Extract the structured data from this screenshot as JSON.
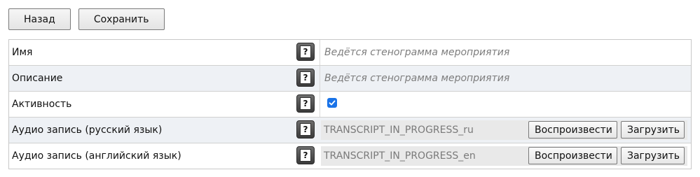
{
  "toolbar": {
    "back_label": "Назад",
    "save_label": "Сохранить"
  },
  "rows": [
    {
      "label": "Имя",
      "placeholder": "Ведётся стенограмма мероприятия"
    },
    {
      "label": "Описание",
      "placeholder": "Ведётся стенограмма мероприятия"
    },
    {
      "label": "Активность",
      "checked": true
    },
    {
      "label": "Аудио запись (русский язык)",
      "value": "TRANSCRIPT_IN_PROGRESS_ru",
      "play_label": "Воспроизвести",
      "upload_label": "Загрузить"
    },
    {
      "label": "Аудио запись (английский язык)",
      "value": "TRANSCRIPT_IN_PROGRESS_en",
      "play_label": "Воспроизвести",
      "upload_label": "Загрузить"
    }
  ],
  "help_icon": "question-mark-icon",
  "colors": {
    "accent": "#1a73e8",
    "alt_row": "#eef1f5",
    "border": "#c8c8c8"
  }
}
